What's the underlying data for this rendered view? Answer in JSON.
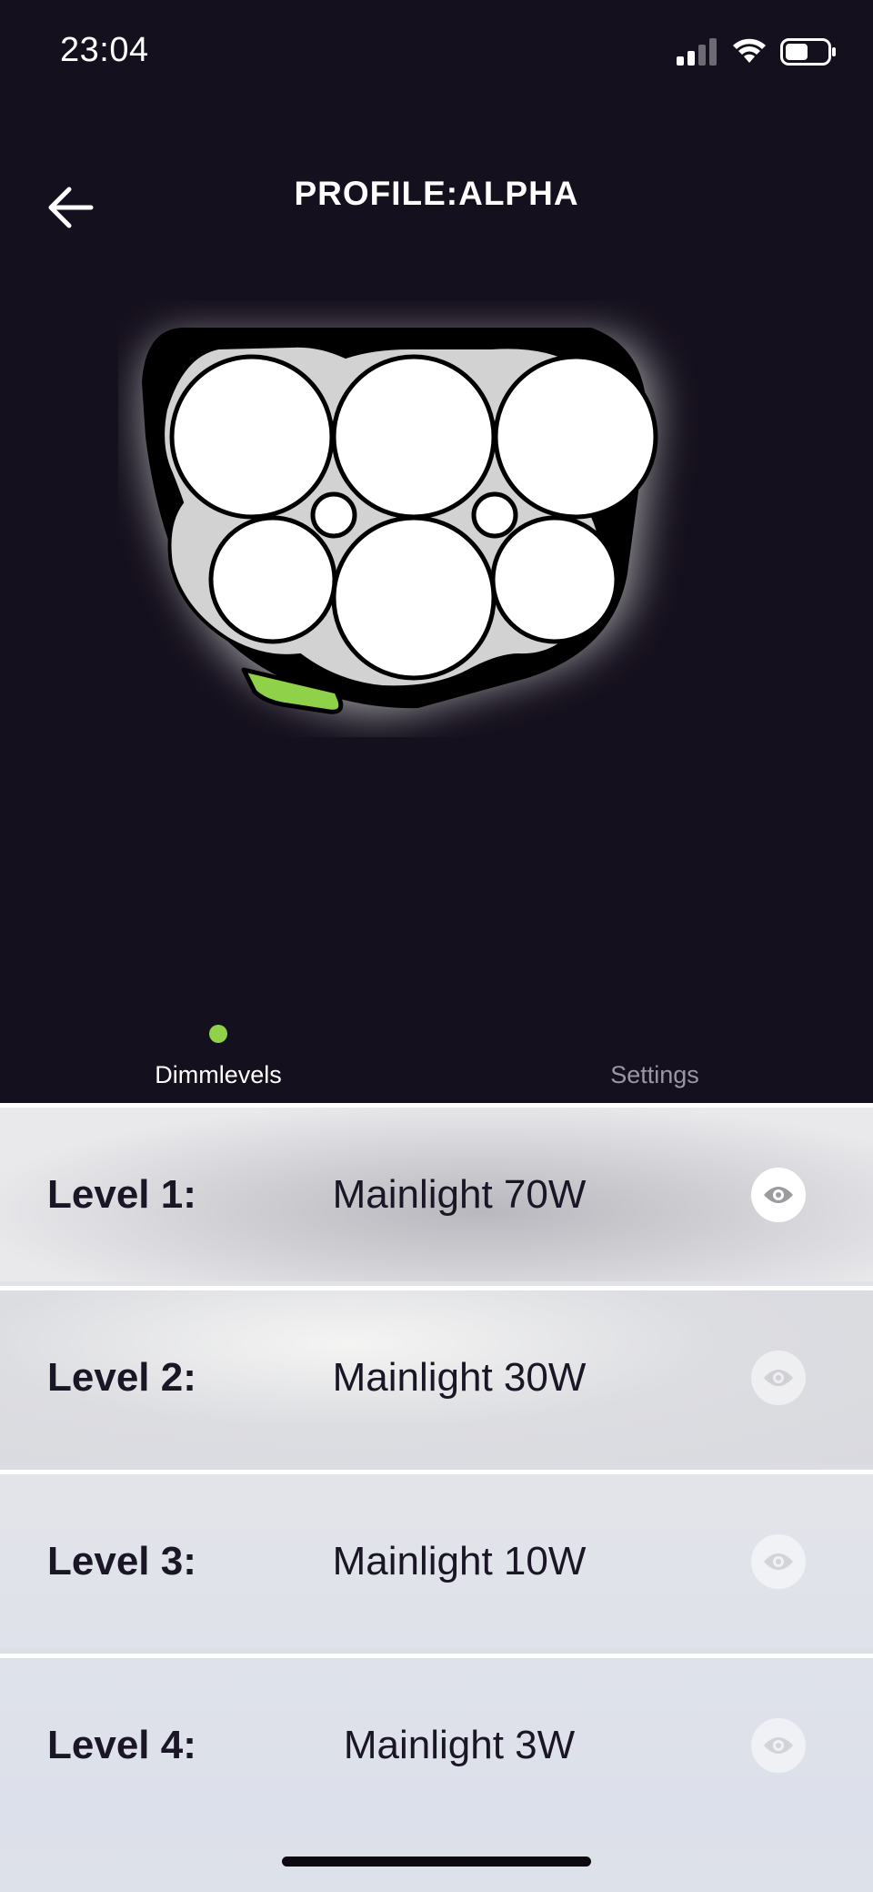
{
  "status_bar": {
    "time": "23:04",
    "icons": [
      "signal-icon",
      "wifi-icon",
      "battery-icon"
    ]
  },
  "header": {
    "title": "PROFILE:ALPHA",
    "back_icon": "arrow-left-icon"
  },
  "tabs": [
    {
      "label": "Dimmlevels",
      "active": true
    },
    {
      "label": "Settings",
      "active": false
    }
  ],
  "levels": [
    {
      "label": "Level 1:",
      "value": "Mainlight 70W",
      "visible": true
    },
    {
      "label": "Level 2:",
      "value": "Mainlight 30W",
      "visible": false
    },
    {
      "label": "Level 3:",
      "value": "Mainlight 10W",
      "visible": false
    },
    {
      "label": "Level 4:",
      "value": "Mainlight 3W",
      "visible": false
    }
  ],
  "colors": {
    "background": "#15101d",
    "accent": "#8fd24a",
    "text_dark": "#1a1626"
  }
}
